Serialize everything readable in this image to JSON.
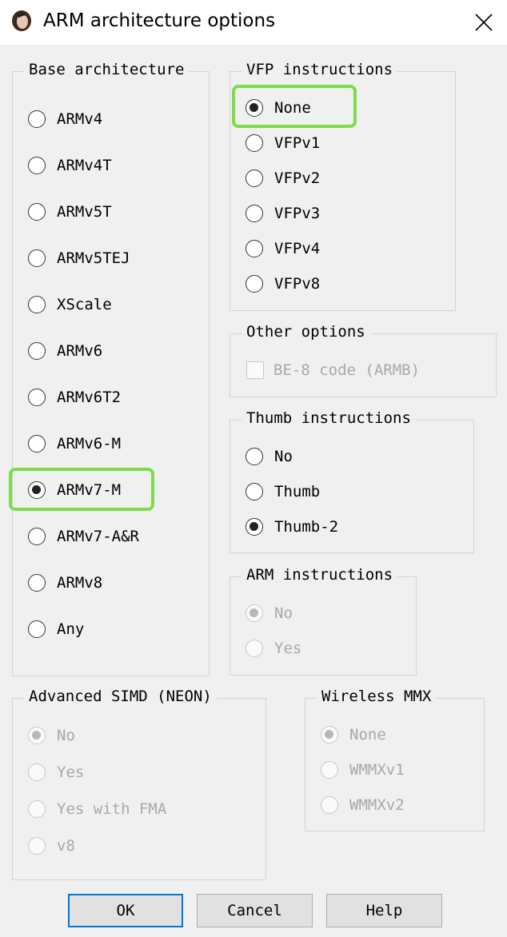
{
  "window": {
    "title": "ARM architecture options"
  },
  "base_architecture": {
    "title": "Base architecture",
    "options": [
      "ARMv4",
      "ARMv4T",
      "ARMv5T",
      "ARMv5TEJ",
      "XScale",
      "ARMv6",
      "ARMv6T2",
      "ARMv6-M",
      "ARMv7-M",
      "ARMv7-A&R",
      "ARMv8",
      "Any"
    ],
    "selected": "ARMv7-M"
  },
  "vfp_instructions": {
    "title": "VFP instructions",
    "options": [
      "None",
      "VFPv1",
      "VFPv2",
      "VFPv3",
      "VFPv4",
      "VFPv8"
    ],
    "selected": "None"
  },
  "other_options": {
    "title": "Other options",
    "be8_label": "BE-8 code (ARMB)",
    "be8_checked": false
  },
  "thumb_instructions": {
    "title": "Thumb instructions",
    "options": [
      "No",
      "Thumb",
      "Thumb-2"
    ],
    "selected": "Thumb-2"
  },
  "arm_instructions": {
    "title": "ARM instructions",
    "options": [
      "No",
      "Yes"
    ],
    "selected": "No"
  },
  "advanced_simd": {
    "title": "Advanced SIMD (NEON)",
    "options": [
      "No",
      "Yes",
      "Yes with FMA",
      "v8"
    ],
    "selected": "No"
  },
  "wireless_mmx": {
    "title": "Wireless MMX",
    "options": [
      "None",
      "WMMXv1",
      "WMMXv2"
    ],
    "selected": "None"
  },
  "buttons": {
    "ok": "OK",
    "cancel": "Cancel",
    "help": "Help"
  },
  "highlight_color": "#7ddc4c",
  "accent_color": "#0078d7"
}
